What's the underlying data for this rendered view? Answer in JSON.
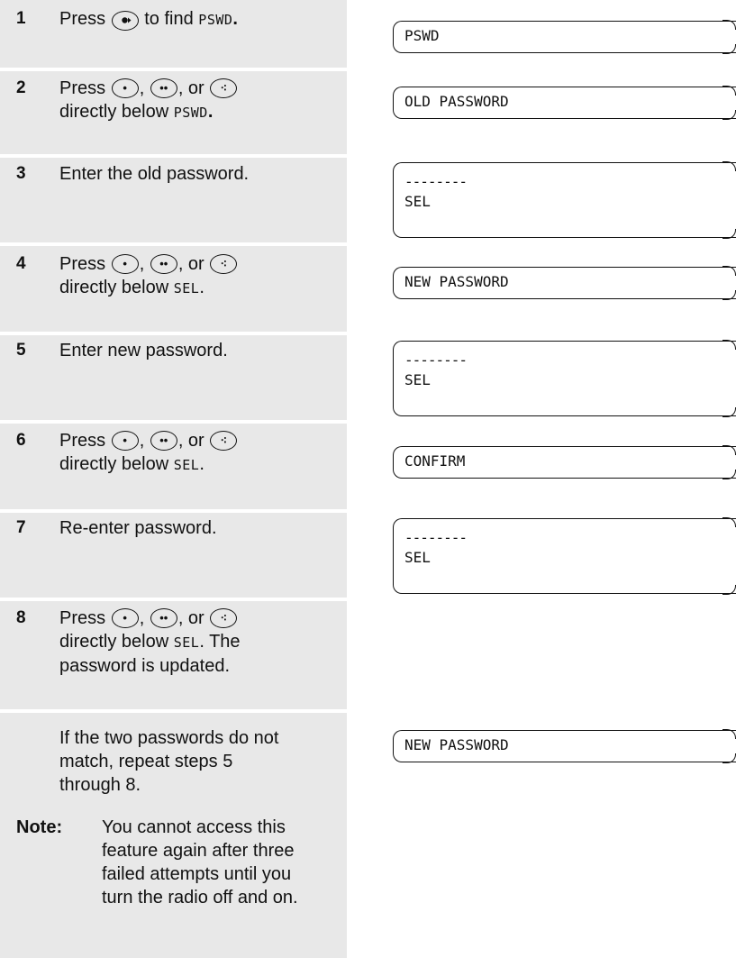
{
  "steps": [
    {
      "num": "1",
      "a": "Press ",
      "b": " to find ",
      "c": "PSWD",
      "d": "."
    },
    {
      "num": "2",
      "l1": "Press ",
      "or": ", or ",
      "l2": "directly below ",
      "target": "PSWD",
      "end": "."
    },
    {
      "num": "3",
      "text": "Enter the old password."
    },
    {
      "num": "4",
      "l1": "Press ",
      "or": ", or ",
      "l2": "directly below ",
      "target": "SEL",
      "end": "."
    },
    {
      "num": "5",
      "text": "Enter new password."
    },
    {
      "num": "6",
      "l1": "Press ",
      "or": ", or ",
      "l2": "directly below ",
      "target": "SEL",
      "end": "."
    },
    {
      "num": "7",
      "text": "Re-enter password."
    },
    {
      "num": "8",
      "l1": "Press ",
      "or": ", or ",
      "l2": "directly below ",
      "target": "SEL",
      "l3": ". The",
      "l4": "password is updated."
    }
  ],
  "mismatch": {
    "l1": "If the two passwords do not",
    "l2": "match, repeat steps 5",
    "l3": "through 8."
  },
  "note": {
    "label": "Note:",
    "l1": "You cannot access this",
    "l2": "feature again after three",
    "l3": "failed attempts until you",
    "l4": "turn the radio off and on."
  },
  "screens": {
    "s1": "PSWD",
    "s2": "OLD PASSWORD",
    "s3_dash": "--------",
    "s3_sel": "SEL",
    "s4": "NEW PASSWORD",
    "s5_dash": "--------",
    "s5_sel": "SEL",
    "s6": "CONFIRM",
    "s7_dash": "--------",
    "s7_sel": "SEL",
    "s8": "NEW PASSWORD"
  },
  "icons": {
    "nav": "nav-right-button-icon",
    "one_dot": "one-dot-button-icon",
    "two_dot": "two-dot-button-icon",
    "three_dot": "three-dot-button-icon"
  }
}
